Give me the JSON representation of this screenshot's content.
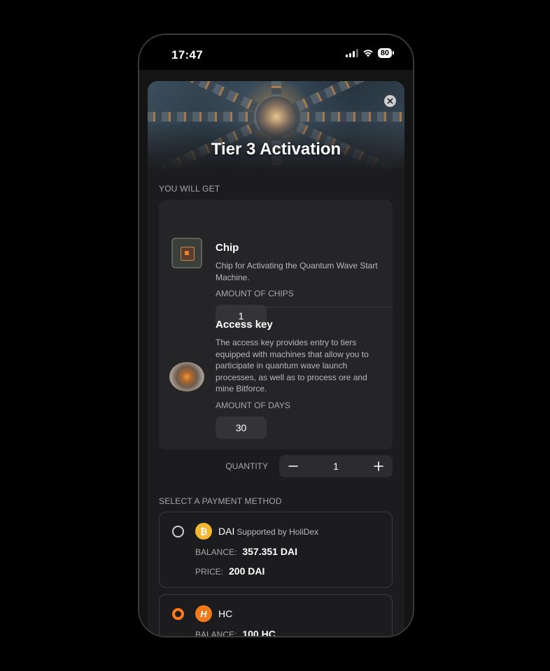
{
  "status_bar": {
    "time": "17:47",
    "battery": "80"
  },
  "modal": {
    "title": "Tier 3 Activation",
    "you_will_get_label": "YOU WILL GET",
    "items": [
      {
        "title": "Chip",
        "description": "Chip for Activating the Quantum Wave Start Machine.",
        "amount_label": "AMOUNT OF CHIPS",
        "amount": "1",
        "icon": "chip-image"
      },
      {
        "title": "Access key",
        "description": "The access key provides entry to tiers equipped with machines that allow you to participate in quantum wave launch processes, as well as to process ore and mine Bitforce.",
        "amount_label": "AMOUNT OF DAYS",
        "amount": "30",
        "icon": "access-key-image"
      }
    ],
    "quantity": {
      "label": "QUANTITY",
      "value": "1"
    },
    "payment_label": "SELECT A PAYMENT METHOD",
    "payment_methods": [
      {
        "name": "DAI",
        "subtitle": "Supported by HoliDex",
        "coin_glyph": "₿",
        "balance_label": "BALANCE:",
        "balance": "357.351 DAI",
        "price_label": "PRICE:",
        "price": "200 DAI",
        "selected": false
      },
      {
        "name": "HC",
        "coin_glyph": "H",
        "balance_label": "BALANCE:",
        "balance": "100 HC",
        "selected": true
      }
    ]
  },
  "colors": {
    "accent": "#ff7a1a",
    "dai": "#f4b731",
    "hc": "#f07a1a",
    "card": "#252527",
    "modal": "#1c1c1e"
  }
}
